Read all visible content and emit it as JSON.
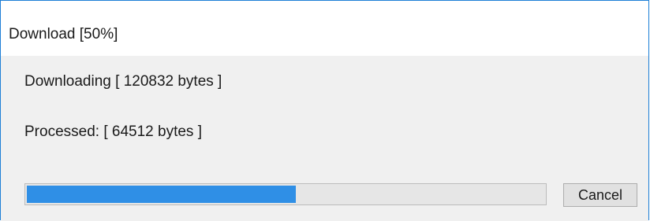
{
  "window": {
    "title": "Download [50%]"
  },
  "status": {
    "downloading_text": "Downloading [ 120832 bytes ]",
    "processed_text": "Processed: [ 64512 bytes ]"
  },
  "progress": {
    "fraction": 0.52,
    "fill_color": "#2f8fe6"
  },
  "buttons": {
    "cancel_label": "Cancel"
  },
  "colors": {
    "window_border": "#1e7fd6",
    "background": "#f0f0f0"
  }
}
